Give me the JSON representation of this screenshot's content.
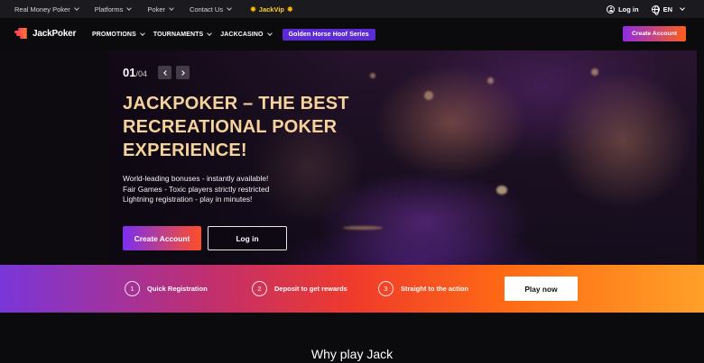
{
  "topbar": {
    "nav": [
      {
        "label": "Real Money Poker",
        "has_dropdown": true
      },
      {
        "label": "Platforms",
        "has_dropdown": true
      },
      {
        "label": "Poker",
        "has_dropdown": true
      },
      {
        "label": "Contact Us",
        "has_dropdown": true
      }
    ],
    "jackvip_label": "JackVip",
    "login_label": "Log in",
    "language": "EN"
  },
  "mainnav": {
    "logo_text": "JackPoker",
    "items": [
      {
        "label": "PROMOTIONS"
      },
      {
        "label": "TOURNAMENTS"
      },
      {
        "label": "JACKCASINO"
      }
    ],
    "promo_badge": "Golden Horse Hoof Series",
    "create_account_label": "Create Account"
  },
  "hero": {
    "slide_current": "01",
    "slide_total": "/04",
    "headline_lines": [
      "JACKPOKER – THE BEST",
      "RECREATIONAL POKER",
      "EXPERIENCE!"
    ],
    "bullets": [
      "World-leading bonuses - instantly available!",
      "Fair Games - Toxic players strictly restricted",
      "Lightning registration - play in minutes!"
    ],
    "create_account_label": "Create Account",
    "login_label": "Log in"
  },
  "steps": {
    "items": [
      {
        "number": "1",
        "label": "Quick Registration"
      },
      {
        "number": "2",
        "label": "Deposit to get rewards"
      },
      {
        "number": "3",
        "label": "Straight to the action"
      }
    ],
    "play_now_label": "Play now"
  },
  "why": {
    "title": "Why play Jack"
  },
  "colors": {
    "accent_gradient_start": "#7b2ff0",
    "accent_gradient_end": "#ff4e28",
    "headline": "#f6d39a",
    "vip": "#ffcc33",
    "promo_badge": "#5b2bd6"
  }
}
